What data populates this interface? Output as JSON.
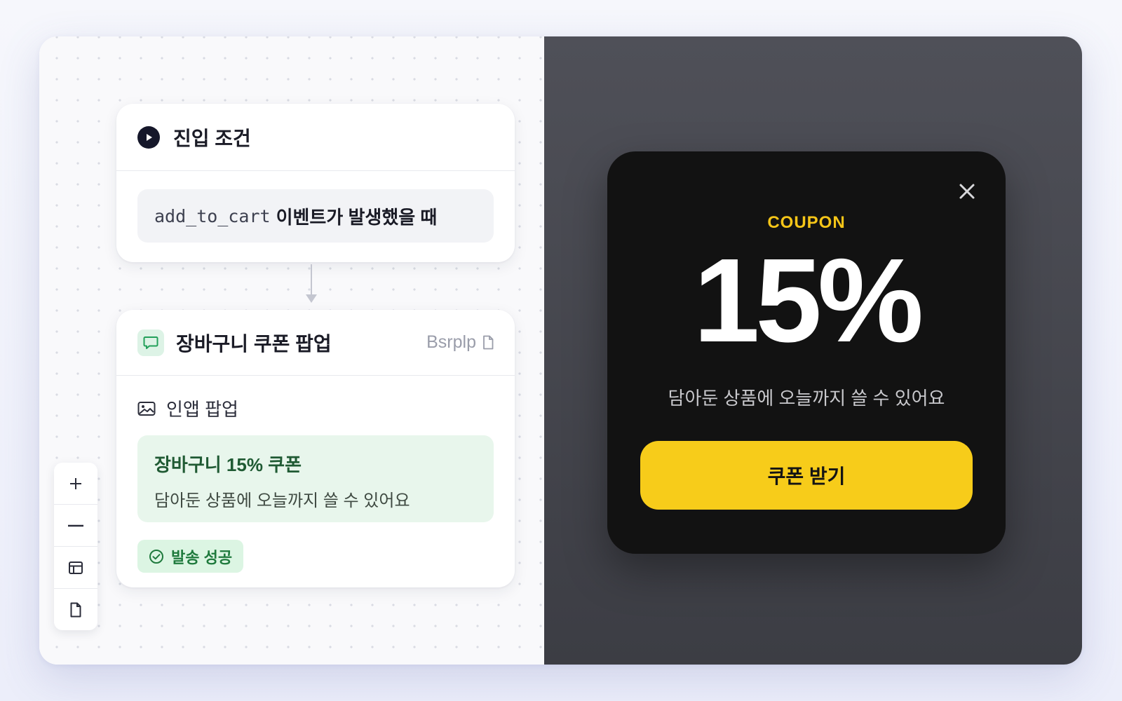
{
  "entry_card": {
    "title": "진입 조건",
    "condition_code": "add_to_cart",
    "condition_text": "이벤트가 발생했을 때"
  },
  "popup_card": {
    "title": "장바구니 쿠폰 팝업",
    "code": "Bsrplp",
    "subtype_label": "인앱 팝업",
    "content_title": "장바구니 15% 쿠폰",
    "content_body": "담아둔 상품에 오늘까지 쓸 수 있어요",
    "status": "발송 성공"
  },
  "toolbar": {
    "tools": [
      "zoom-in",
      "zoom-out",
      "layout",
      "document"
    ]
  },
  "preview": {
    "label": "COUPON",
    "percent": "15%",
    "description": "담아둔 상품에 오늘까지 쓸 수 있어요",
    "cta": "쿠폰 받기"
  },
  "colors": {
    "accent_yellow": "#f7cc1a",
    "popup_bg": "#121212",
    "success_green": "#1f7a3d",
    "preview_bg": "#45464d"
  }
}
